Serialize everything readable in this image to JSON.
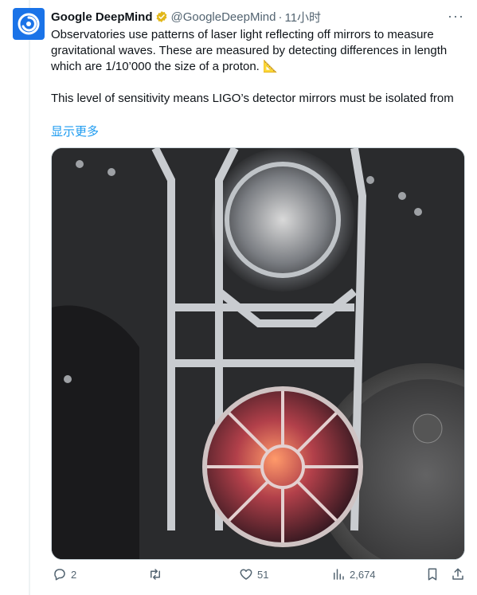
{
  "tweet": {
    "author": {
      "name": "Google DeepMind",
      "handle": "@GoogleDeepMind",
      "separator": "·",
      "time": "11小时",
      "avatar_icon": "deepmind-logo-icon",
      "verified_icon": "verified-badge-icon",
      "verified_color": "#e2b719"
    },
    "paragraph1": "Observatories use patterns of laser light reflecting off mirrors to measure gravitational waves. These are measured by detecting differences in length which are 1/10’000 the size of a proton. 📐",
    "paragraph2": "This level of sensitivity means LIGO’s detector mirrors must be isolated from",
    "show_more": "显示更多",
    "more_icon": "···",
    "media": {
      "description_icon": "ligo-mirror-photo"
    },
    "actions": {
      "replies": "2",
      "retweets": "",
      "likes": "51",
      "views": "2,674"
    },
    "colors": {
      "link": "#1d9bf0",
      "secondary": "#536471",
      "avatar_bg": "#1a73e8"
    }
  }
}
